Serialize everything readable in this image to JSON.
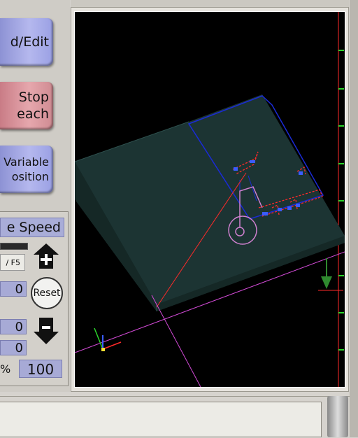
{
  "buttons": {
    "load_edit": "d/Edit",
    "stop_teach_line1": "Stop",
    "stop_teach_line2": "each",
    "variable_position_line1": "Variable",
    "variable_position_line2": "osition"
  },
  "speed": {
    "title": "e Speed",
    "key_hint": "/ F5",
    "values": [
      "0",
      "0",
      "0"
    ],
    "reset_label": "Reset",
    "percent_symbol": "%",
    "percent_value": "100",
    "plus_icon": "plus-icon",
    "minus_icon": "minus-icon"
  },
  "viewport": {
    "background": "#000000",
    "plate_color": "#1c3433",
    "outline_color": "#1a2bd6",
    "red_line_color": "#ff2a2a",
    "magenta_line_color": "#d24ad6",
    "tick_color": "#2bd42b",
    "arrow_color": "#2f8a2f"
  }
}
